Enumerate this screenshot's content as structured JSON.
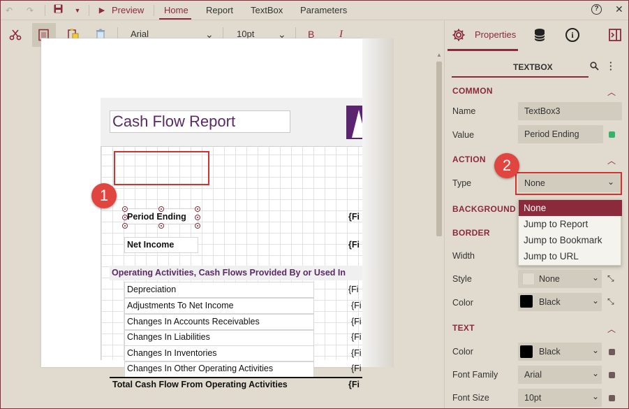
{
  "menubar": {
    "preview_label": "Preview",
    "tabs": [
      {
        "label": "Home",
        "active": true
      },
      {
        "label": "Report",
        "active": false
      },
      {
        "label": "TextBox",
        "active": false
      },
      {
        "label": "Parameters",
        "active": false
      }
    ],
    "help_glyph": "?",
    "close_glyph": "✕"
  },
  "toolbar": {
    "font_family": "Arial",
    "font_size": "10pt",
    "bold_label": "B",
    "italic_label": "I"
  },
  "report": {
    "title": "Cash Flow Report",
    "period_ending": "Period Ending",
    "net_income": "Net Income",
    "field_prefix": "{Fi",
    "section_heading": "Operating Activities, Cash Flows Provided By or Used In",
    "rows": [
      "Depreciation",
      "Adjustments To Net Income",
      "Changes In Accounts Receivables",
      "Changes In Liabilities",
      "Changes In Inventories",
      "Changes In Other Operating Activities"
    ],
    "total_label": "Total Cash Flow From Operating Activities"
  },
  "callouts": {
    "one": "1",
    "two": "2"
  },
  "panel": {
    "properties_label": "Properties",
    "object_title": "TEXTBOX",
    "sections": {
      "common": "COMMON",
      "action": "ACTION",
      "background": "BACKGROUND",
      "border": "BORDER",
      "text": "TEXT"
    },
    "fields": {
      "name_label": "Name",
      "name_value": "TextBox3",
      "value_label": "Value",
      "value_value": "Period Ending",
      "type_label": "Type",
      "type_value": "None",
      "width_label": "Width",
      "style_label": "Style",
      "style_value": "None",
      "border_color_label": "Color",
      "border_color_value": "Black",
      "text_color_label": "Color",
      "text_color_value": "Black",
      "font_family_label": "Font Family",
      "font_family_value": "Arial",
      "font_size_label": "Font Size",
      "font_size_value": "10pt"
    },
    "type_options": [
      "None",
      "Jump to Report",
      "Jump to Bookmark",
      "Jump to URL"
    ]
  },
  "colors": {
    "accent": "#8a2a3a",
    "title_purple": "#5b2a66",
    "callout_red": "#e0453f",
    "status_green": "#34b36a"
  }
}
